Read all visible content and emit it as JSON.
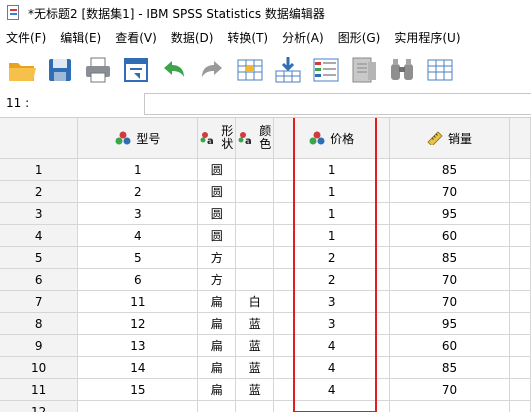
{
  "window": {
    "title": "*无标题2 [数据集1] - IBM SPSS Statistics 数据编辑器"
  },
  "menu": [
    "文件(F)",
    "编辑(E)",
    "查看(V)",
    "数据(D)",
    "转换(T)",
    "分析(A)",
    "图形(G)",
    "实用程序(U)"
  ],
  "toolbar": {
    "icons": [
      "open-folder-icon",
      "save-icon",
      "print-icon",
      "recall-dialog-icon",
      "undo-icon",
      "redo-icon",
      "goto-case-icon",
      "goto-variable-icon",
      "variables-icon",
      "find-icon",
      "binoculars-icon",
      "insert-cases-icon"
    ]
  },
  "cell_editor": {
    "ref": "11 :",
    "value": ""
  },
  "columns": {
    "model": "型号",
    "shape_line1": "形",
    "shape_line2": "状",
    "color_line1": "颜",
    "color_line2": "色",
    "price": "价格",
    "sales": "销量"
  },
  "rows": [
    {
      "n": "1",
      "model": "1",
      "shape": "圆",
      "color": "",
      "price": "1",
      "sales": "85"
    },
    {
      "n": "2",
      "model": "2",
      "shape": "圆",
      "color": "",
      "price": "1",
      "sales": "70"
    },
    {
      "n": "3",
      "model": "3",
      "shape": "圆",
      "color": "",
      "price": "1",
      "sales": "95"
    },
    {
      "n": "4",
      "model": "4",
      "shape": "圆",
      "color": "",
      "price": "1",
      "sales": "60"
    },
    {
      "n": "5",
      "model": "5",
      "shape": "方",
      "color": "",
      "price": "2",
      "sales": "85"
    },
    {
      "n": "6",
      "model": "6",
      "shape": "方",
      "color": "",
      "price": "2",
      "sales": "70"
    },
    {
      "n": "7",
      "model": "11",
      "shape": "扁",
      "color": "白",
      "price": "3",
      "sales": "70"
    },
    {
      "n": "8",
      "model": "12",
      "shape": "扁",
      "color": "蓝",
      "price": "3",
      "sales": "95"
    },
    {
      "n": "9",
      "model": "13",
      "shape": "扁",
      "color": "蓝",
      "price": "4",
      "sales": "60"
    },
    {
      "n": "10",
      "model": "14",
      "shape": "扁",
      "color": "蓝",
      "price": "4",
      "sales": "85"
    },
    {
      "n": "11",
      "model": "15",
      "shape": "扁",
      "color": "蓝",
      "price": "4",
      "sales": "70"
    },
    {
      "n": "12",
      "model": "",
      "shape": "",
      "color": "",
      "price": "",
      "sales": ""
    }
  ],
  "colors": {
    "highlight": "#e01e1e",
    "header_bg": "#f3f3f3",
    "grid_line": "#d6d6d6"
  }
}
